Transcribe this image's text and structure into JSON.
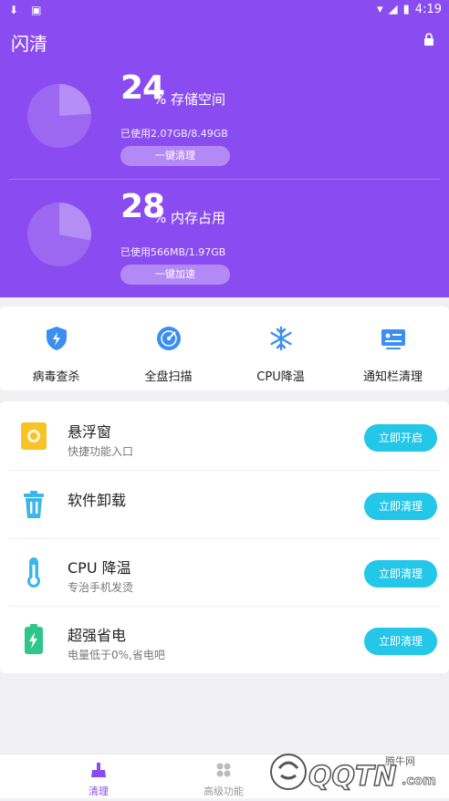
{
  "status_bar": {
    "time": "4:19"
  },
  "header": {
    "title": "闪清"
  },
  "storage": {
    "percent": "24",
    "label": "% 存储空间",
    "used": "已使用2.07GB/8.49GB",
    "button": "一键清理",
    "fraction": 0.24
  },
  "memory": {
    "percent": "28",
    "label": "% 内存占用",
    "used": "已使用566MB/1.97GB",
    "button": "一键加速",
    "fraction": 0.28
  },
  "quick_actions": [
    {
      "label": "病毒查杀",
      "icon": "shield-icon"
    },
    {
      "label": "全盘扫描",
      "icon": "radar-icon"
    },
    {
      "label": "CPU降温",
      "icon": "snowflake-icon"
    },
    {
      "label": "通知栏清理",
      "icon": "notification-card-icon"
    }
  ],
  "features": [
    {
      "title": "悬浮窗",
      "subtitle": "快捷功能入口",
      "button": "立即开启",
      "icon": "floating-window-icon"
    },
    {
      "title": "软件卸载",
      "subtitle": "",
      "button": "立即清理",
      "icon": "trash-icon"
    },
    {
      "title": "CPU 降温",
      "subtitle": "专治手机发烫",
      "button": "立即清理",
      "icon": "thermometer-icon"
    },
    {
      "title": "超强省电",
      "subtitle": "电量低于0%,省电吧",
      "button": "立即清理",
      "icon": "battery-icon"
    }
  ],
  "bottom_nav": [
    {
      "label": "清理",
      "active": true,
      "icon": "broom-icon"
    },
    {
      "label": "高级功能",
      "active": false,
      "icon": "grid-icon"
    }
  ],
  "watermark": {
    "text": "QQTN",
    "suffix": ".com",
    "cn": "腾牛网"
  },
  "colors": {
    "primary": "#8a4cf0",
    "accent": "#24c7e8"
  }
}
